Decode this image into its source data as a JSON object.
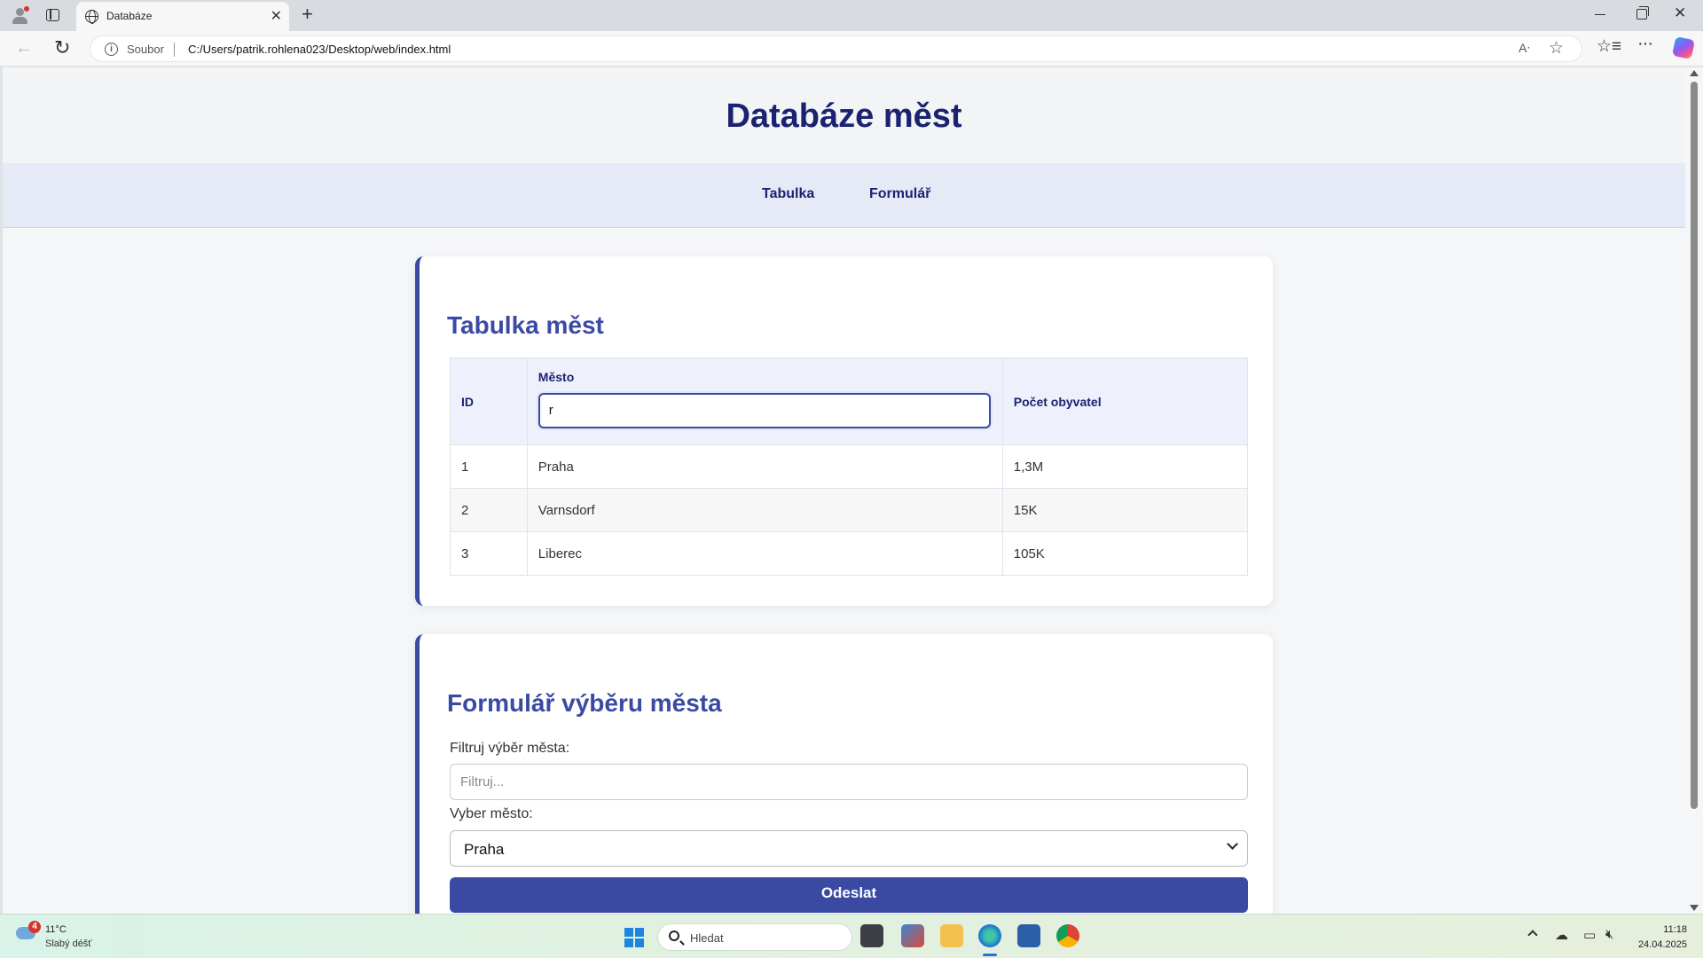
{
  "browser": {
    "tab_title": "Databáze",
    "address_scheme": "Soubor",
    "address_url": "C:/Users/patrik.rohlena023/Desktop/web/index.html"
  },
  "page": {
    "site_title": "Databáze měst",
    "nav": [
      {
        "label": "Tabulka"
      },
      {
        "label": "Formulář"
      }
    ],
    "table_card": {
      "heading": "Tabulka měst",
      "columns": [
        "ID",
        "Město",
        "Počet obyvatel"
      ],
      "filter_value": "r",
      "rows": [
        {
          "id": "1",
          "city": "Praha",
          "population": "1,3M"
        },
        {
          "id": "2",
          "city": "Varnsdorf",
          "population": "15K"
        },
        {
          "id": "3",
          "city": "Liberec",
          "population": "105K"
        }
      ]
    },
    "form_card": {
      "heading": "Formulář výběru města",
      "filter_label": "Filtruj výběr města:",
      "filter_placeholder": "Filtruj...",
      "select_label": "Vyber město:",
      "select_value": "Praha",
      "submit_label": "Odeslat"
    }
  },
  "taskbar": {
    "weather_badge": "4",
    "temperature": "11°C",
    "weather_text": "Slabý déšť",
    "search_placeholder": "Hledat",
    "time": "11:18",
    "date": "24.04.2025"
  },
  "colors": {
    "brand_dark": "#1b2371",
    "accent": "#3a4aa3"
  }
}
